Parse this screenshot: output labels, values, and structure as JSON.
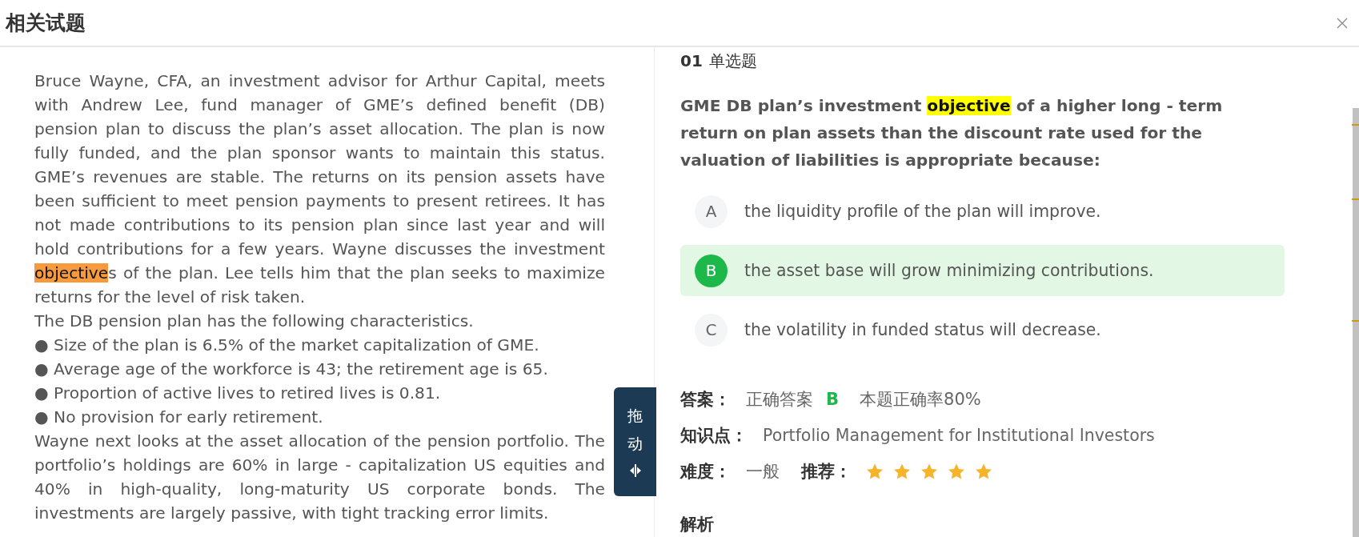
{
  "dialog": {
    "title": "相关试题"
  },
  "passage": {
    "paragraphs": [
      {
        "segments": [
          {
            "text": "Bruce Wayne, CFA, an investment advisor for Arthur Capital, meets with Andrew Lee, fund manager of GME’s defined benefit (DB) pension plan to discuss the plan’s asset allocation. The plan is now fully funded, and the plan sponsor wants to maintain this status. GME’s revenues are stable. The returns on its pension assets have been sufficient to meet pension payments to present retirees. It has not made contributions to its pension plan since last year and will hold contributions for a few years. Wayne discusses the investment ",
            "highlighted": false
          },
          {
            "text": "objective",
            "highlighted": true,
            "color": "#f79a3e"
          },
          {
            "text": "s of the plan. Lee tells him that the plan seeks to maximize returns for the level of risk taken.",
            "highlighted": false
          }
        ]
      },
      {
        "segments": [
          {
            "text": "The DB pension plan has the following characteristics.",
            "highlighted": false
          }
        ]
      },
      {
        "segments": [
          {
            "text": "● Size of the plan is 6.5% of the market capitalization of GME.",
            "highlighted": false
          }
        ]
      },
      {
        "segments": [
          {
            "text": "● Average age of the workforce is 43; the retirement age is 65.",
            "highlighted": false
          }
        ]
      },
      {
        "segments": [
          {
            "text": "● Proportion of active lives to retired lives is 0.81.",
            "highlighted": false
          }
        ]
      },
      {
        "segments": [
          {
            "text": "● No provision for early retirement.",
            "highlighted": false
          }
        ]
      },
      {
        "segments": [
          {
            "text": "Wayne next looks at the asset allocation of the pension portfolio. The portfolio’s holdings are 60% in large - capitalization US equities and 40% in high-quality, long-maturity US corporate bonds. The investments are largely passive, with tight tracking error limits.",
            "highlighted": false
          }
        ]
      }
    ]
  },
  "drag_handle": {
    "label": "拖动"
  },
  "question": {
    "number": "01",
    "type": "单选题",
    "segments": [
      {
        "text": "GME DB plan’s investment ",
        "highlighted": false
      },
      {
        "text": "objective",
        "highlighted": true,
        "color": "#ffff00"
      },
      {
        "text": " of a higher long - term return on plan assets than the discount rate used for the valuation of liabilities is appropriate because:",
        "highlighted": false
      }
    ],
    "options": [
      {
        "letter": "A",
        "text": "the liquidity profile of the plan will improve.",
        "selected": false
      },
      {
        "letter": "B",
        "text": "the asset base will grow minimizing contributions.",
        "selected": true
      },
      {
        "letter": "C",
        "text": "the volatility in funded status will decrease.",
        "selected": false
      }
    ]
  },
  "answer": {
    "label": "答案：",
    "correct_label": "正确答案",
    "correct_letter": "B",
    "accuracy": "本题正确率80%"
  },
  "knowledge_point": {
    "label": "知识点：",
    "value": "Portfolio Management for Institutional Investors"
  },
  "difficulty": {
    "label": "难度：",
    "value": "一般"
  },
  "recommendation": {
    "label": "推荐：",
    "stars": 5
  },
  "analysis": {
    "title": "解析"
  }
}
